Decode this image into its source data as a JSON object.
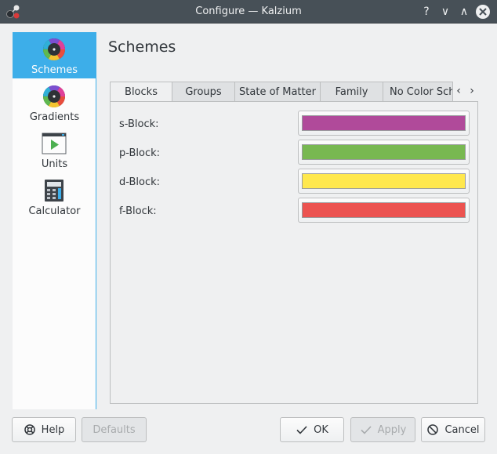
{
  "window": {
    "title": "Configure — Kalzium",
    "help_glyph": "?",
    "minimize_glyph": "∨",
    "maximize_glyph": "∧"
  },
  "sidebar": {
    "items": [
      {
        "label": "Schemes",
        "icon": "color-wheel-icon",
        "active": true
      },
      {
        "label": "Gradients",
        "icon": "color-wheel-icon",
        "active": false
      },
      {
        "label": "Units",
        "icon": "units-window-icon",
        "active": false
      },
      {
        "label": "Calculator",
        "icon": "calculator-icon",
        "active": false
      }
    ]
  },
  "page": {
    "title": "Schemes"
  },
  "tabs": [
    {
      "label": "Blocks",
      "active": true
    },
    {
      "label": "Groups",
      "active": false
    },
    {
      "label": "State of Matter",
      "active": false
    },
    {
      "label": "Family",
      "active": false
    },
    {
      "label": "No Color Sche",
      "active": false
    }
  ],
  "tab_scroll": {
    "left": "‹",
    "right": "›"
  },
  "blocks": [
    {
      "label": "s-Block:",
      "color": "#b04a9a"
    },
    {
      "label": "p-Block:",
      "color": "#78b851"
    },
    {
      "label": "d-Block:",
      "color": "#ffe84d"
    },
    {
      "label": "f-Block:",
      "color": "#ec5350"
    }
  ],
  "buttons": {
    "help": "Help",
    "defaults": "Defaults",
    "ok": "OK",
    "apply": "Apply",
    "cancel": "Cancel"
  },
  "colors": {
    "accent": "#3daee9",
    "titlebar": "#475057",
    "window_bg": "#eff0f1"
  }
}
